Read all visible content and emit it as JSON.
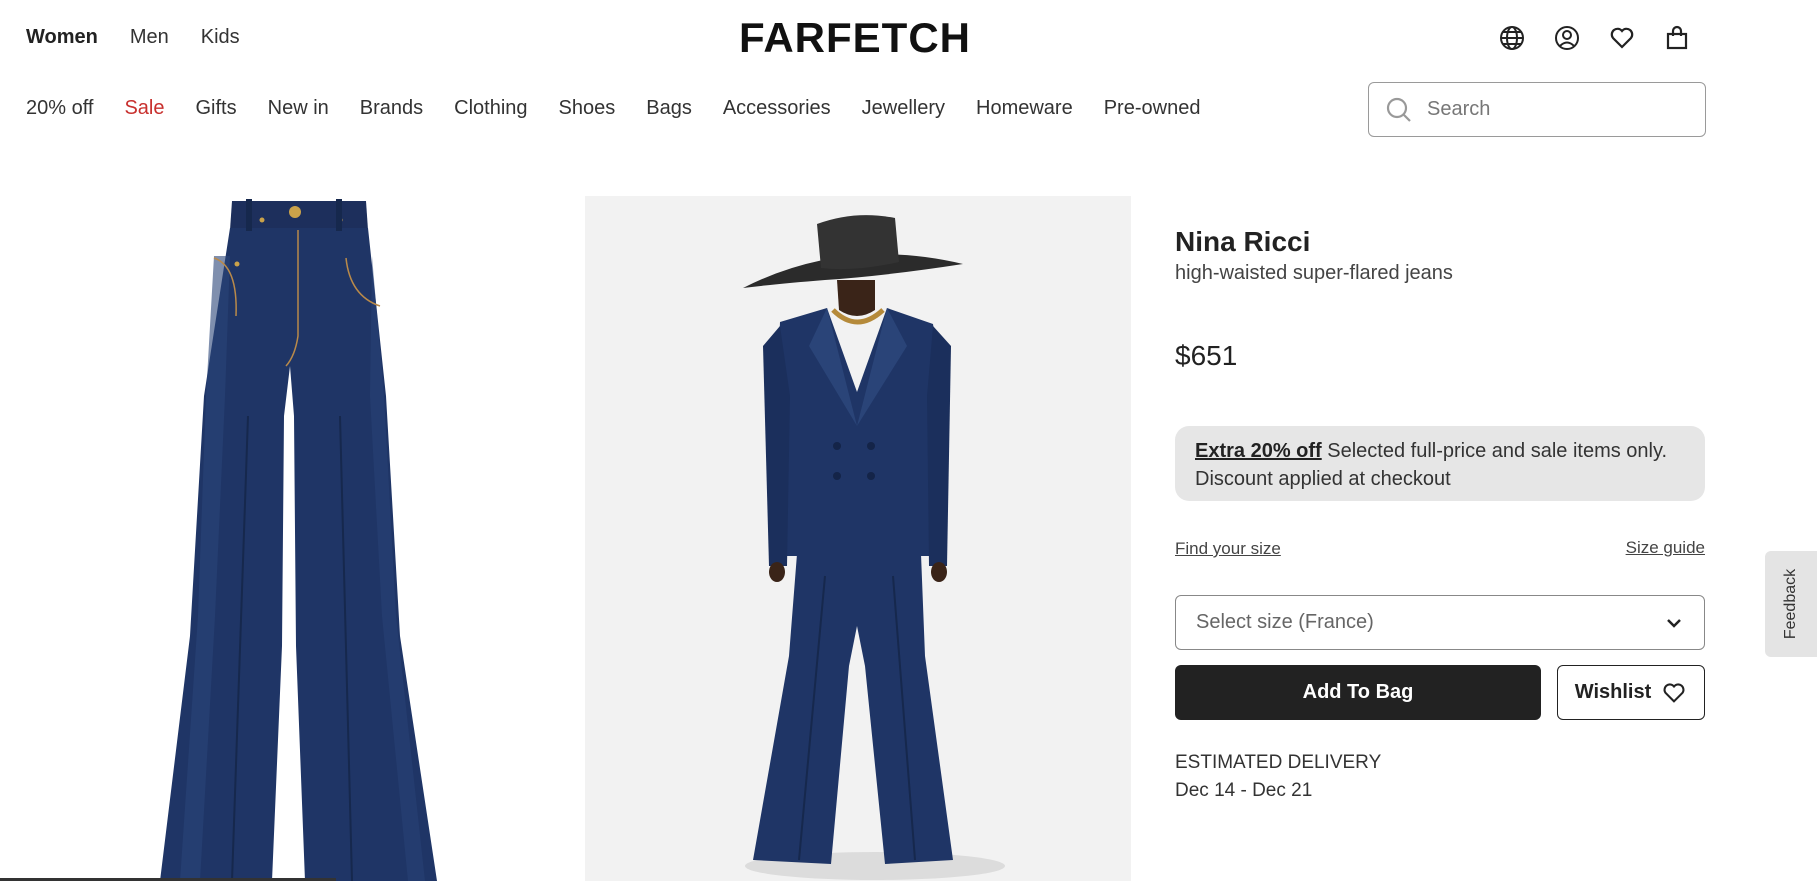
{
  "header": {
    "gender_nav": [
      {
        "label": "Women"
      },
      {
        "label": "Men"
      },
      {
        "label": "Kids"
      }
    ],
    "logo": "FARFETCH",
    "icons": [
      "globe-icon",
      "account-icon",
      "wishlist-heart-icon",
      "shopping-bag-icon"
    ]
  },
  "category_nav": [
    {
      "label": "20% off"
    },
    {
      "label": "Sale"
    },
    {
      "label": "Gifts"
    },
    {
      "label": "New in"
    },
    {
      "label": "Brands"
    },
    {
      "label": "Clothing"
    },
    {
      "label": "Shoes"
    },
    {
      "label": "Bags"
    },
    {
      "label": "Accessories"
    },
    {
      "label": "Jewellery"
    },
    {
      "label": "Homeware"
    },
    {
      "label": "Pre-owned"
    }
  ],
  "search": {
    "placeholder": "Search"
  },
  "product": {
    "brand": "Nina Ricci",
    "description": "high-waisted super-flared jeans",
    "price": "$651",
    "promo": {
      "link": "Extra 20% off",
      "text": " Selected full-price and sale items only. Discount applied at checkout"
    },
    "find_size": "Find your size",
    "size_guide": "Size guide",
    "size_select": "Select size (France)",
    "add_to_bag": "Add To Bag",
    "wishlist": "Wishlist",
    "delivery_label": "ESTIMATED DELIVERY",
    "delivery_dates": "Dec 14 - Dec 21"
  },
  "feedback": "Feedback",
  "colors": {
    "sale": "#c8302e",
    "denim": "#1f3566",
    "button_dark": "#222222",
    "promo_bg": "#e6e6e6"
  }
}
